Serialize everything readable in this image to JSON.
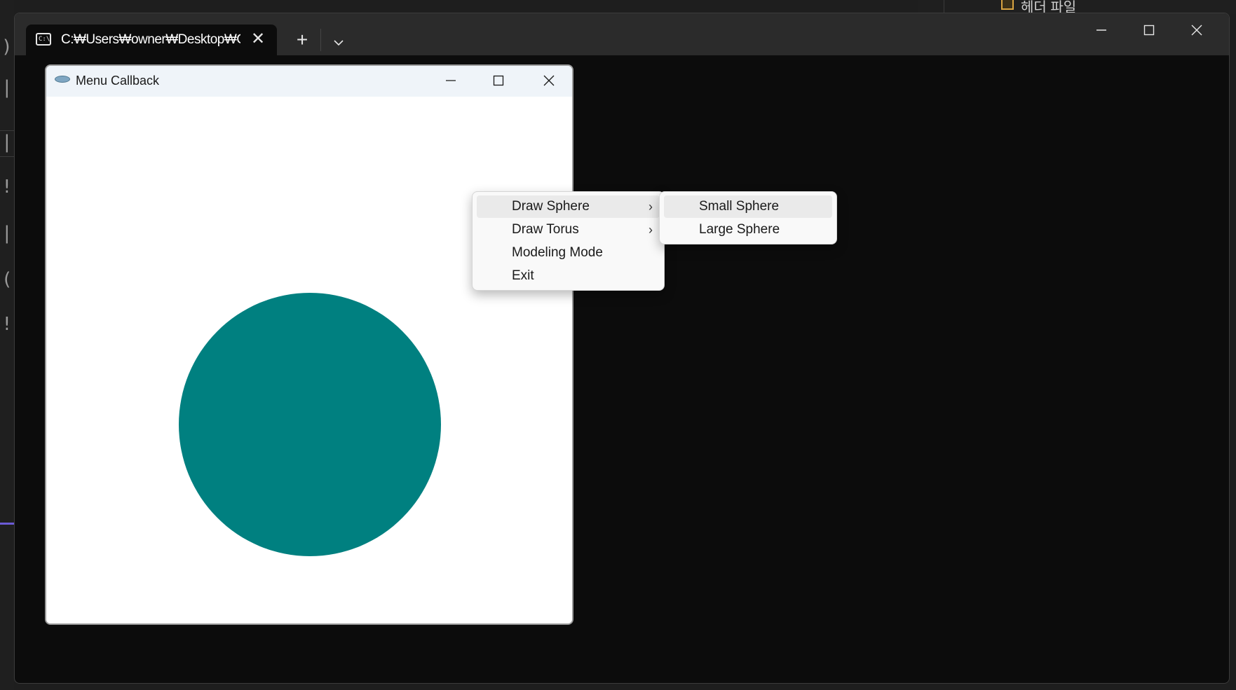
{
  "background": {
    "editor_glyphs": [
      ")",
      "|s",
      "|s",
      "!",
      "|s",
      "(",
      "!"
    ],
    "right_panel_label": "헤더 파일"
  },
  "terminal": {
    "tab_title": "C:₩Users₩owner₩Desktop₩C",
    "tab_icon_text": "C:\\",
    "new_tab_symbol": "+",
    "dropdown_symbol": "⌄",
    "close_tab_symbol": "✕",
    "minimize_symbol": "—",
    "maximize_symbol": "☐",
    "close_symbol": "✕"
  },
  "glut_window": {
    "title": "Menu Callback",
    "minimize_symbol": "—",
    "maximize_symbol": "☐",
    "close_symbol": "✕",
    "sphere_color": "#008080"
  },
  "context_menu": {
    "items": [
      {
        "label": "Draw Sphere",
        "has_submenu": true
      },
      {
        "label": "Draw Torus",
        "has_submenu": true
      },
      {
        "label": "Modeling Mode",
        "has_submenu": false
      },
      {
        "label": "Exit",
        "has_submenu": false
      }
    ],
    "submenu_chevron": "›"
  },
  "submenu": {
    "items": [
      {
        "label": "Small Sphere"
      },
      {
        "label": "Large Sphere"
      }
    ]
  }
}
